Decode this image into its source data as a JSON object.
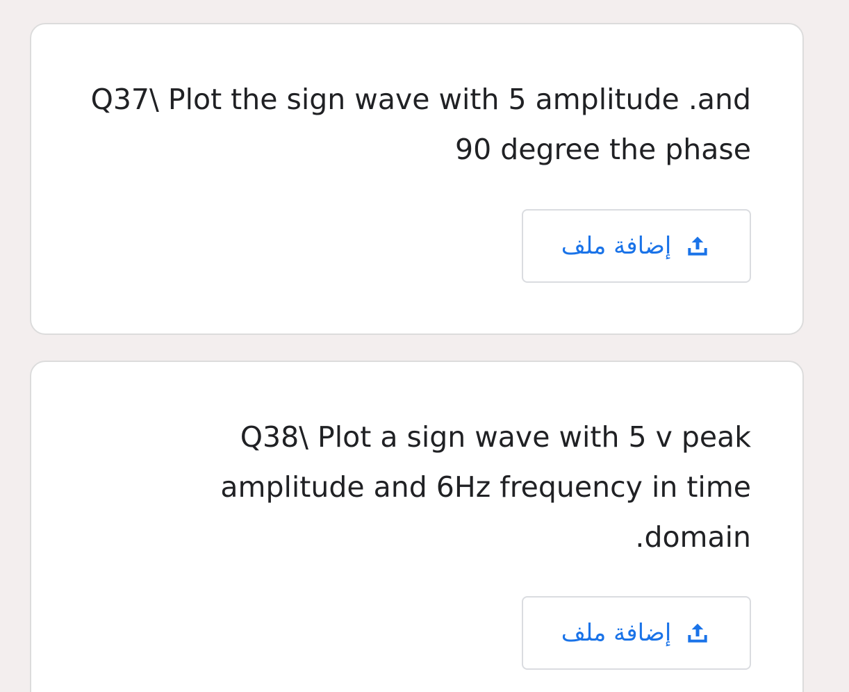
{
  "questions": [
    {
      "text": "Q37\\ Plot the sign wave with 5 amplitude .and 90 degree the phase",
      "upload_label": "إضافة ملف",
      "upload_icon": "upload-icon"
    },
    {
      "text": "Q38\\ Plot a sign wave with 5 v peak amplitude and 6Hz frequency in time .domain",
      "upload_label": "إضافة ملف",
      "upload_icon": "upload-icon"
    }
  ],
  "colors": {
    "page_background": "#f3eeee",
    "card_background": "#ffffff",
    "accent": "#1a73e8",
    "text": "#202124",
    "border": "#dcdcdc"
  }
}
